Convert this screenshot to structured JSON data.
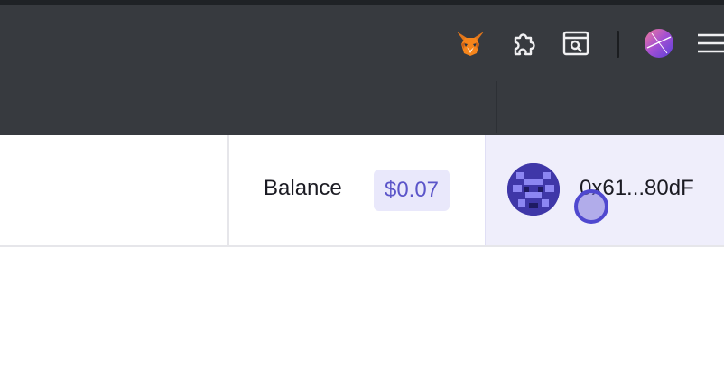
{
  "browser_toolbar": {
    "icons": [
      "metamask-fox-icon",
      "extensions-puzzle-icon",
      "screenshot-search-icon",
      "profile-avatar-icon",
      "hamburger-menu-icon"
    ],
    "colors": {
      "toolbar_bg": "#373a3f"
    }
  },
  "app_header": {
    "balance_label": "Balance",
    "balance_value": "$0.07",
    "account_address": "0x61...80dF"
  },
  "colors": {
    "accent": "#5b55c9",
    "chip_bg": "#e9e8fb",
    "account_bg": "#efeefb"
  }
}
